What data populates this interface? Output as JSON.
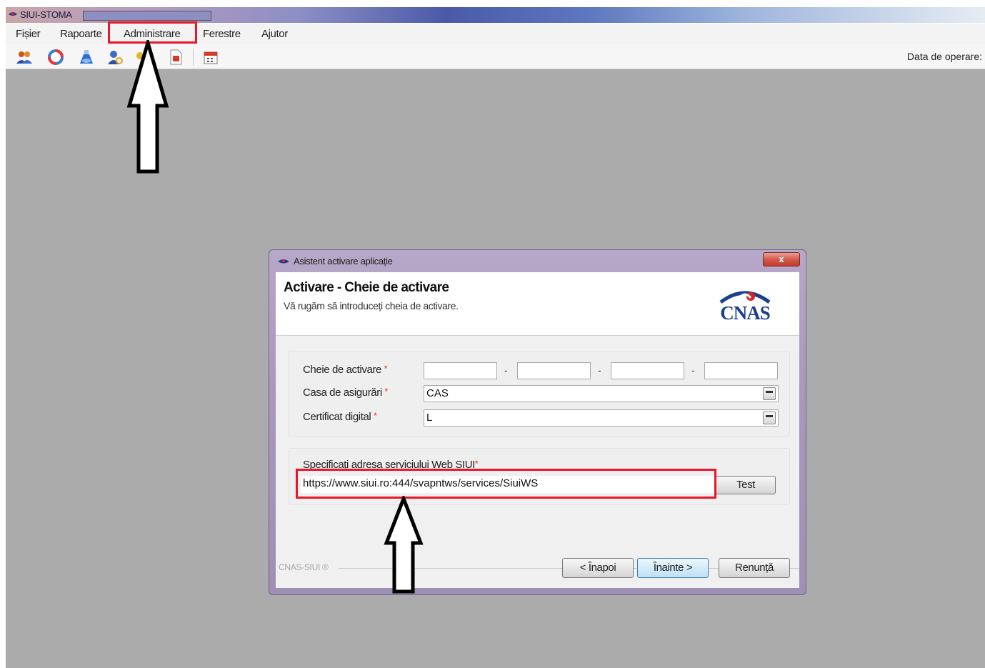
{
  "app": {
    "title": "SIUI-STOMA"
  },
  "menu": {
    "items": [
      "Fișier",
      "Rapoarte",
      "Administrare",
      "Ferestre",
      "Ajutor"
    ]
  },
  "toolbar": {
    "icons": [
      "users-icon",
      "lifebuoy-icon",
      "flask-icon",
      "user-ring-icon",
      "key-icon",
      "document-icon",
      "calendar-icon"
    ],
    "operation_date_label": "Data de operare:"
  },
  "dialog": {
    "title": "Asistent activare aplicație",
    "close_label": "x",
    "heading": "Activare - Cheie de activare",
    "subheading": "Vă rugăm să introduceți cheia de activare.",
    "logo_text": "CNAS",
    "fields": {
      "activation_key": {
        "label": "Cheie de activare",
        "required": "*",
        "separator": "-",
        "parts": [
          "",
          "",
          "",
          ""
        ]
      },
      "insurance_house": {
        "label": "Casa de asigurări",
        "required": "*",
        "value": "CAS"
      },
      "certificate": {
        "label": "Certificat digital",
        "required": "*",
        "value": "L"
      }
    },
    "web_service": {
      "label": "Specificați adresa serviciului Web SIUI",
      "required": "*",
      "url": "https://www.siui.ro:444/svapntws/services/SiuiWS",
      "test_button": "Test"
    },
    "footer_label": "CNAS-SIUI ®",
    "buttons": {
      "back": "< Înapoi",
      "next": "Înainte >",
      "cancel": "Renunță"
    }
  },
  "colors": {
    "highlight": "#e8172a",
    "workspace": "#ababab",
    "brand": "#1c3f8a"
  }
}
